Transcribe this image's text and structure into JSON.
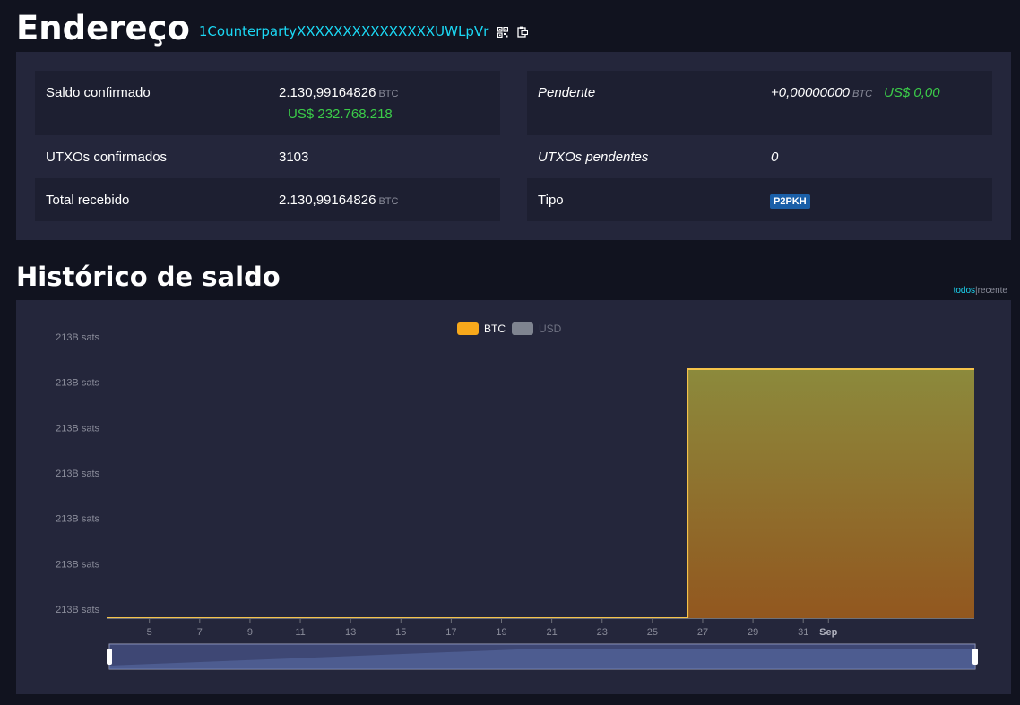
{
  "header": {
    "title": "Endereço",
    "address": "1CounterpartyXXXXXXXXXXXXXXXUWLpVr",
    "qr_icon": "qr-code-icon",
    "copy_icon": "clipboard-copy-icon"
  },
  "stats": {
    "confirmed_balance_label": "Saldo confirmado",
    "confirmed_balance_value": "2.130,99164826",
    "confirmed_balance_unit": "BTC",
    "confirmed_balance_fiat": "US$ 232.768.218",
    "confirmed_utxos_label": "UTXOs confirmados",
    "confirmed_utxos_value": "3103",
    "total_received_label": "Total recebido",
    "total_received_value": "2.130,99164826",
    "total_received_unit": "BTC",
    "pending_label": "Pendente",
    "pending_value": "+0,00000000",
    "pending_unit": "BTC",
    "pending_fiat": "US$ 0,00",
    "pending_utxos_label": "UTXOs pendentes",
    "pending_utxos_value": "0",
    "type_label": "Tipo",
    "type_value": "P2PKH"
  },
  "history": {
    "title": "Histórico de saldo",
    "range_all": "todos",
    "range_separator": "|",
    "range_recent": "recente"
  },
  "colors": {
    "accent": "#1bd8f4",
    "fiat": "#3bcc49",
    "btc_series": "#f7a81b",
    "usd_series": "#7f8490",
    "badge": "#1a5fa8"
  },
  "chart_data": {
    "type": "area",
    "legend": [
      {
        "name": "BTC",
        "active": true
      },
      {
        "name": "USD",
        "active": false
      }
    ],
    "legend_placement": "top-center",
    "ytick_labels": [
      "213B sats",
      "213B sats",
      "213B sats",
      "213B sats",
      "213B sats",
      "213B sats",
      "213B sats"
    ],
    "xtick_labels": [
      "5",
      "7",
      "9",
      "11",
      "13",
      "15",
      "17",
      "19",
      "21",
      "23",
      "25",
      "27",
      "29",
      "31",
      "Sep"
    ],
    "x_range_days": [
      3.3,
      37.8
    ],
    "xtick_days": [
      5,
      7,
      9,
      11,
      13,
      15,
      17,
      19,
      21,
      23,
      25,
      27,
      29,
      31,
      32
    ],
    "series": [
      {
        "name": "BTC",
        "x": [
          3.3,
          26.4,
          26.4,
          37.8
        ],
        "y": [
          0,
          0,
          1,
          1
        ]
      }
    ],
    "y_normalized": true,
    "grid": false,
    "data_zoom": {
      "start": 0,
      "end": 1
    }
  }
}
